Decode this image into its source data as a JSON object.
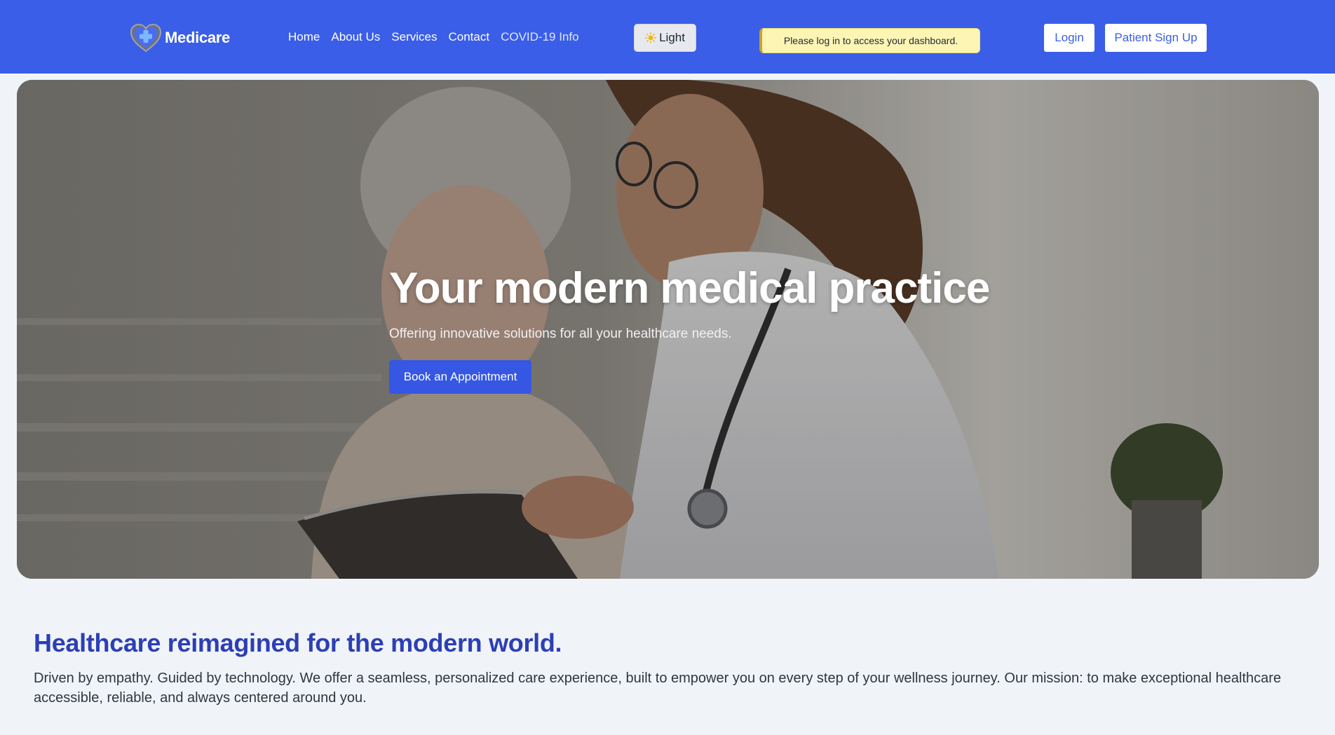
{
  "colors": {
    "brand": "#3a5ee8",
    "cta": "#3557e4",
    "heading": "#2c3fb5",
    "alert_bg": "#fdf5b3",
    "page_bg": "#f0f3f8"
  },
  "navbar": {
    "brand_name": "Medicare",
    "logo_icon": "heart-cross-icon",
    "links": [
      {
        "label": "Home"
      },
      {
        "label": "About Us"
      },
      {
        "label": "Services"
      },
      {
        "label": "Contact"
      },
      {
        "label": "COVID-19 Info"
      }
    ],
    "theme_toggle": {
      "label": "Light",
      "icon": "sun-icon"
    },
    "alert": "Please log in to access your dashboard.",
    "login_label": "Login",
    "signup_label": "Patient Sign Up"
  },
  "hero": {
    "title": "Your modern medical practice",
    "subtitle": "Offering innovative solutions for all your healthcare needs.",
    "cta_label": "Book an Appointment"
  },
  "mission": {
    "title": "Healthcare reimagined for the modern world.",
    "text": "Driven by empathy. Guided by technology. We offer a seamless, personalized care experience, built to empower you on every step of your wellness journey. Our mission: to make exceptional healthcare accessible, reliable, and always centered around you."
  }
}
